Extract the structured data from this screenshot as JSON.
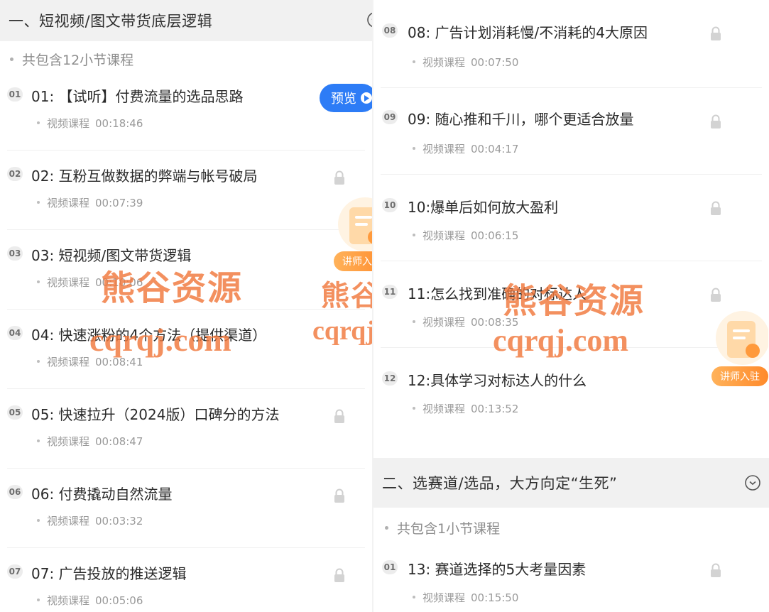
{
  "sections": [
    {
      "title": "一、短视频/图文带货底层逻辑",
      "count_label": "共包含12小节课程",
      "lessons": [
        {
          "badge": "01",
          "title": "01: 【试听】付费流量的选品思路",
          "type": "视频课程",
          "duration": "00:18:46",
          "locked": false
        },
        {
          "badge": "02",
          "title": "02: 互粉互做数据的弊端与帐号破局",
          "type": "视频课程",
          "duration": "00:07:39",
          "locked": true
        },
        {
          "badge": "03",
          "title": "03: 短视频/图文带货逻辑",
          "type": "视频课程",
          "duration": "00:10:06",
          "locked": true
        },
        {
          "badge": "04",
          "title": "04: 快速涨粉的4个方法（提供渠道）",
          "type": "视频课程",
          "duration": "00:08:41",
          "locked": true
        },
        {
          "badge": "05",
          "title": "05: 快速拉升（2024版）口碑分的方法",
          "type": "视频课程",
          "duration": "00:08:47",
          "locked": true
        },
        {
          "badge": "06",
          "title": "06: 付费撬动自然流量",
          "type": "视频课程",
          "duration": "00:03:32",
          "locked": true
        },
        {
          "badge": "07",
          "title": "07: 广告投放的推送逻辑",
          "type": "视频课程",
          "duration": "00:05:06",
          "locked": true
        },
        {
          "badge": "08",
          "title": "08: 广告计划消耗慢/不消耗的4大原因",
          "type": "视频课程",
          "duration": "00:07:50",
          "locked": true
        },
        {
          "badge": "09",
          "title": "09: 随心推和千川，哪个更适合放量",
          "type": "视频课程",
          "duration": "00:04:17",
          "locked": true
        },
        {
          "badge": "10",
          "title": "10:爆单后如何放大盈利",
          "type": "视频课程",
          "duration": "00:06:15",
          "locked": true
        },
        {
          "badge": "11",
          "title": "11:怎么找到准确的对标达人",
          "type": "视频课程",
          "duration": "00:08:35",
          "locked": true
        },
        {
          "badge": "12",
          "title": "12:具体学习对标达人的什么",
          "type": "视频课程",
          "duration": "00:13:52",
          "locked": true
        }
      ]
    },
    {
      "title": "二、选赛道/选品，大方向定“生死”",
      "count_label": "共包含1小节课程",
      "lessons": [
        {
          "badge": "01",
          "title": "13: 赛道选择的5大考量因素",
          "type": "视频课程",
          "duration": "00:15:50",
          "locked": true
        }
      ]
    }
  ],
  "preview_button": {
    "label": "预览"
  },
  "instructor_badge": {
    "label": "讲师入驻"
  },
  "watermark": {
    "cn": "熊谷资源",
    "url": "cqrqj.com"
  },
  "colors": {
    "accent_blue": "#2d7cf6",
    "header_bg": "#f1f1f1",
    "watermark": "#f0783c",
    "badge_orange": "#ff8a2b"
  },
  "icons": [
    "lock-icon",
    "play-icon",
    "chevron-down-circle-icon",
    "instructor-doc-icon"
  ]
}
